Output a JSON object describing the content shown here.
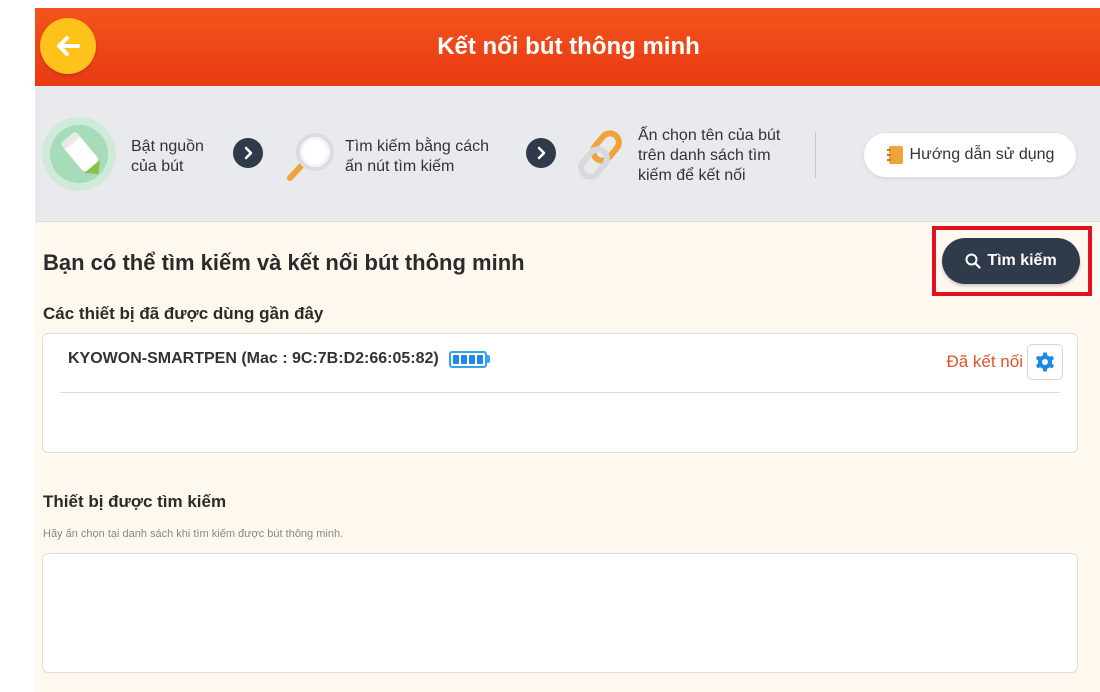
{
  "header": {
    "title": "Kết nối bút thông minh"
  },
  "steps": {
    "step1": {
      "line1": "Bật nguồn",
      "line2": "của bút"
    },
    "step2": {
      "line1": "Tìm kiếm bằng cách",
      "line2": "ấn nút tìm kiếm"
    },
    "step3": {
      "line1": "Ấn chọn tên của bút",
      "line2": "trên danh sách tìm",
      "line3": "kiếm để kết nối"
    },
    "guide_label": "Hướng dẫn sử dụng"
  },
  "main": {
    "title": "Bạn có thể tìm kiếm và kết nối bút thông minh",
    "search_label": "Tìm kiếm"
  },
  "recent": {
    "title": "Các thiết bị đã được dùng gần đây",
    "devices": [
      {
        "name": "KYOWON-SMARTPEN (Mac : 9C:7B:D2:66:05:82)",
        "battery_bars": 4,
        "status": "Đã kết nối"
      }
    ]
  },
  "found": {
    "title": "Thiết bị được tìm kiếm",
    "hint": "Hãy ấn chọn tại danh sách khi tìm kiếm được bút thông minh."
  },
  "colors": {
    "header": "#ea3a14",
    "back_button": "#ffc21a",
    "dark_button": "#2f3a4a",
    "status": "#e0532a",
    "highlight": "#e31020",
    "battery": "#1e88e5"
  },
  "icons": {
    "back": "arrow-left-icon",
    "step1": "pen-icon",
    "step2": "magnifier-icon",
    "step3": "link-icon",
    "guide": "notebook-icon",
    "search": "search-icon",
    "settings": "gear-icon"
  }
}
